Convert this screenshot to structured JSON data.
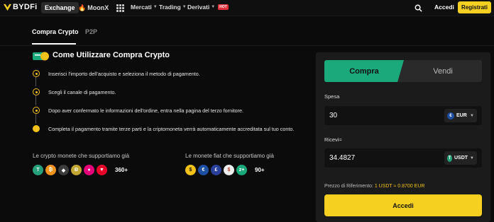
{
  "nav": {
    "logo_text": "BYDFi",
    "exchange": "Exchange",
    "moonx": "MoonX",
    "menus": [
      "Mercati",
      "Trading",
      "Derivati"
    ],
    "hot_badge": "HOT",
    "login": "Accedi",
    "register": "Registrati"
  },
  "subtabs": {
    "buy": "Compra Crypto",
    "p2p": "P2P"
  },
  "howto": {
    "title": "Come Utilizzare Compra Crypto",
    "steps": [
      "Inserisci l'importo dell'acquisto e seleziona il metodo di pagamento.",
      "Scegli il canale di pagamento.",
      "Dopo aver confermato le informazioni dell'ordine, entra nella pagina del terzo fornitore.",
      "Completa il pagamento tramite terze parti e la criptomoneta verrà automaticamente accreditata sul tuo conto."
    ]
  },
  "supported": {
    "crypto_label": "Le crypto monete che supportiamo già",
    "crypto_count": "360+",
    "fiat_label": "Le monete fiat che supportiamo già",
    "fiat_count": "90+"
  },
  "trade": {
    "buy_tab": "Compra",
    "sell_tab": "Vendi",
    "spend_label": "Spesa",
    "spend_value": "30",
    "spend_currency": "EUR",
    "receive_label": "Ricevi≈",
    "receive_value": "34.4827",
    "receive_currency": "USDT",
    "rate_label": "Prezzo di Riferimento:",
    "rate_value": "1 USDT ≈ 0.8700 EUR",
    "submit": "Accedi"
  },
  "colors": {
    "accent_yellow": "#f5d020",
    "buy_green": "#1aa97a",
    "background": "#0b0b0b"
  }
}
